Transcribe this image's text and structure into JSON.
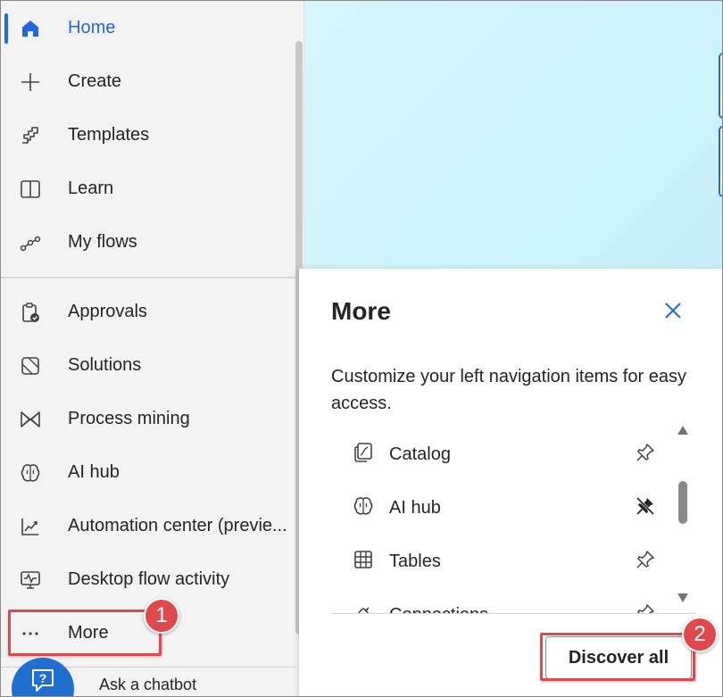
{
  "sidebar": {
    "items": [
      {
        "label": "Home",
        "icon": "home-icon",
        "active": true
      },
      {
        "label": "Create",
        "icon": "plus-icon"
      },
      {
        "label": "Templates",
        "icon": "templates-icon"
      },
      {
        "label": "Learn",
        "icon": "book-icon"
      },
      {
        "label": "My flows",
        "icon": "flows-icon"
      },
      {
        "label": "Approvals",
        "icon": "approvals-icon"
      },
      {
        "label": "Solutions",
        "icon": "solutions-icon"
      },
      {
        "label": "Process mining",
        "icon": "process-mining-icon"
      },
      {
        "label": "AI hub",
        "icon": "brain-icon"
      },
      {
        "label": "Automation center (previe...",
        "icon": "chart-line-icon"
      },
      {
        "label": "Desktop flow activity",
        "icon": "desktop-activity-icon"
      },
      {
        "label": "More",
        "icon": "ellipsis-icon"
      }
    ],
    "chatbot_label": "Ask a chatbot"
  },
  "more_panel": {
    "title": "More",
    "description": "Customize your left navigation items for easy access.",
    "items": [
      {
        "label": "Catalog",
        "icon": "catalog-icon",
        "pinned": false
      },
      {
        "label": "AI hub",
        "icon": "brain-icon",
        "pinned": true
      },
      {
        "label": "Tables",
        "icon": "table-icon",
        "pinned": false
      },
      {
        "label": "Connections",
        "icon": "connections-icon",
        "pinned": false
      }
    ],
    "discover_label": "Discover all"
  },
  "callouts": {
    "first": "1",
    "second": "2"
  },
  "colors": {
    "accent": "#2266e3",
    "callout": "#e0494b",
    "hero": "#d6f6fb"
  }
}
